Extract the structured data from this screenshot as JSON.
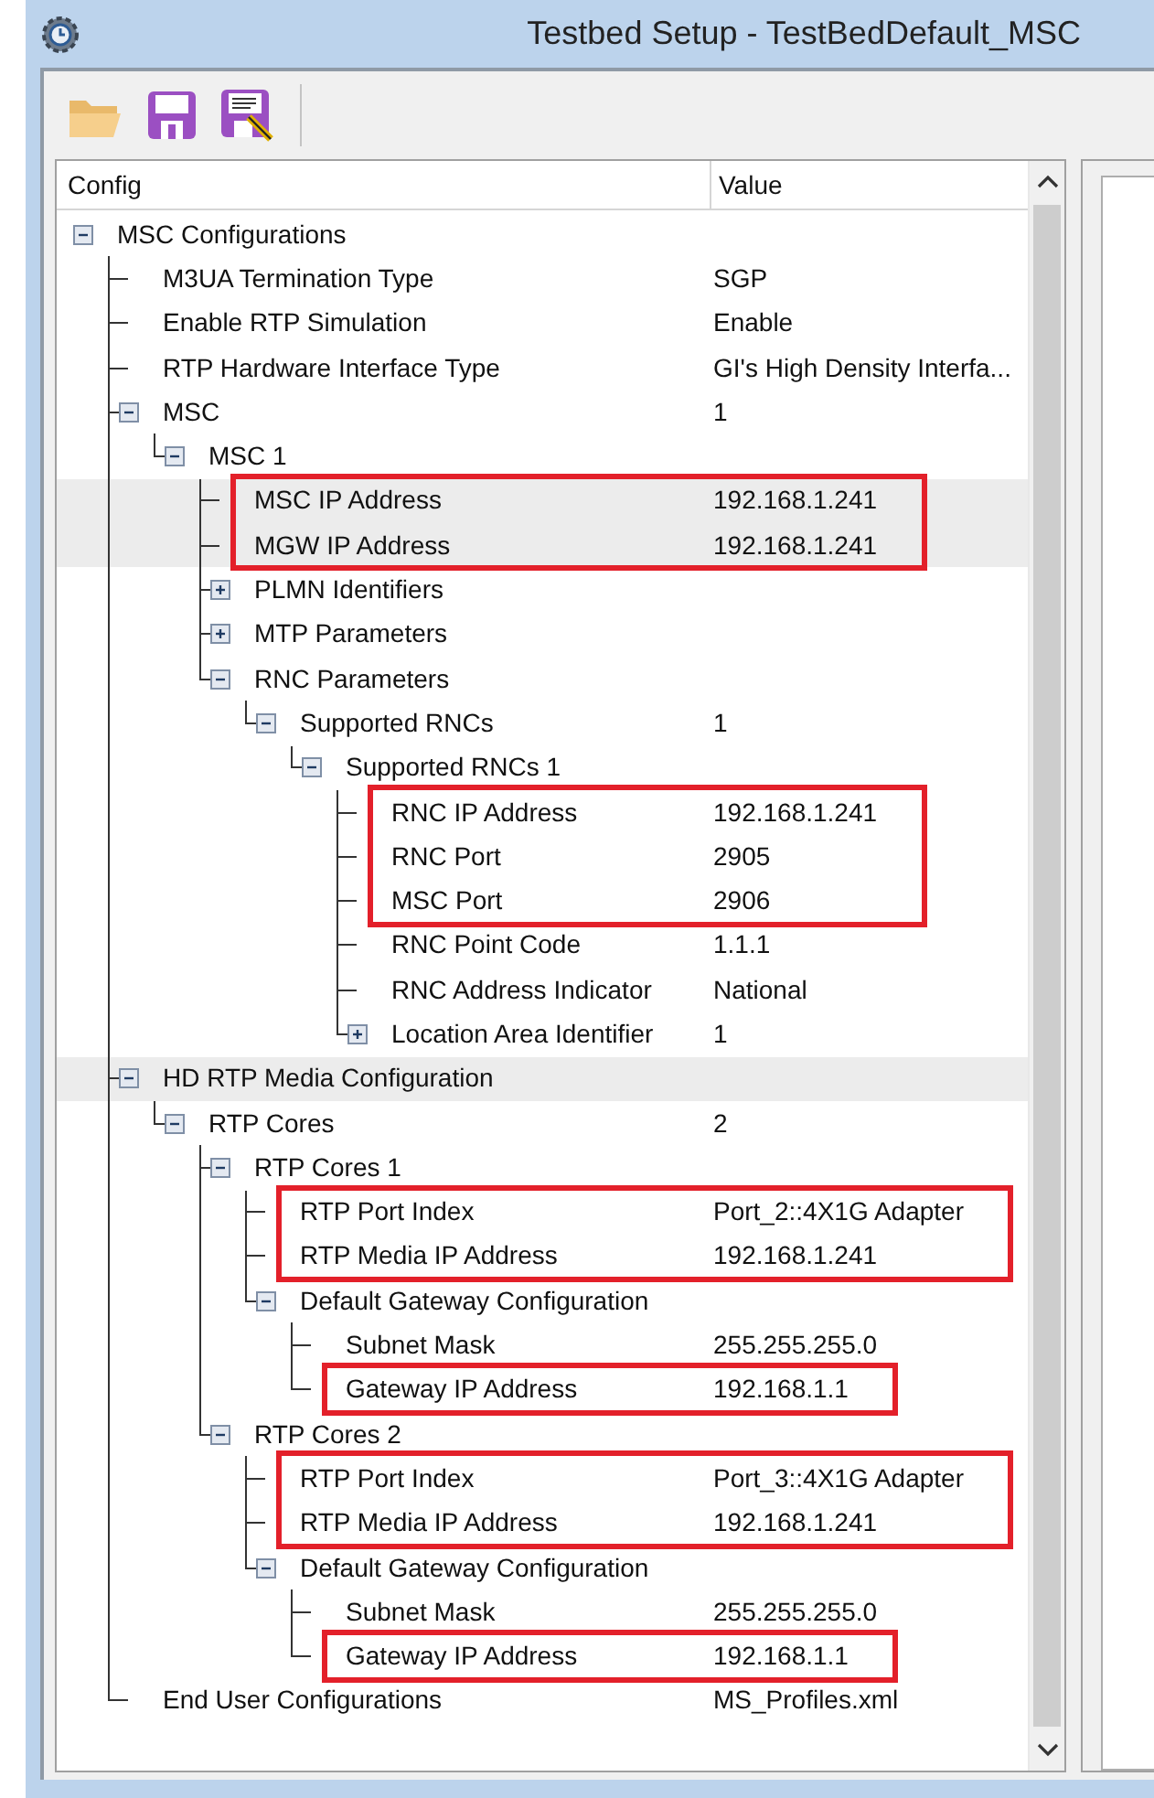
{
  "window": {
    "title": "Testbed Setup - TestBedDefault_MSC"
  },
  "columns": [
    "Config",
    "Value"
  ],
  "tree": [
    {
      "label": "MSC Configurations",
      "expanded": true,
      "selected": false,
      "highlighted": false,
      "children": [
        {
          "label": "M3UA Termination Type",
          "value": "SGP",
          "selected": false,
          "highlighted": false
        },
        {
          "label": "Enable RTP Simulation",
          "value": "Enable",
          "selected": false,
          "highlighted": false
        },
        {
          "label": "RTP Hardware Interface Type",
          "value": "GI's High Density Interfa...",
          "selected": false,
          "highlighted": false
        },
        {
          "label": "MSC",
          "value": "1",
          "expanded": true,
          "selected": false,
          "highlighted": false,
          "children": [
            {
              "label": "MSC 1",
              "expanded": true,
              "selected": false,
              "highlighted": false,
              "children": [
                {
                  "label": "MSC IP Address",
                  "value": "192.168.1.241",
                  "selected": true,
                  "highlighted": true
                },
                {
                  "label": "MGW IP Address",
                  "value": "192.168.1.241",
                  "selected": true,
                  "highlighted": true
                },
                {
                  "label": "PLMN Identifiers",
                  "expanded": false,
                  "selected": false,
                  "highlighted": false
                },
                {
                  "label": "MTP Parameters",
                  "expanded": false,
                  "selected": false,
                  "highlighted": false
                },
                {
                  "label": "RNC Parameters",
                  "expanded": true,
                  "selected": false,
                  "highlighted": false,
                  "children": [
                    {
                      "label": "Supported RNCs",
                      "value": "1",
                      "expanded": true,
                      "selected": false,
                      "highlighted": false,
                      "children": [
                        {
                          "label": "Supported RNCs 1",
                          "expanded": true,
                          "selected": false,
                          "highlighted": false,
                          "children": [
                            {
                              "label": "RNC IP Address",
                              "value": "192.168.1.241",
                              "selected": false,
                              "highlighted": true
                            },
                            {
                              "label": "RNC Port",
                              "value": "2905",
                              "selected": false,
                              "highlighted": true
                            },
                            {
                              "label": "MSC Port",
                              "value": "2906",
                              "selected": false,
                              "highlighted": true
                            },
                            {
                              "label": "RNC Point Code",
                              "value": "1.1.1",
                              "selected": false,
                              "highlighted": false
                            },
                            {
                              "label": "RNC Address Indicator",
                              "value": "National",
                              "selected": false,
                              "highlighted": false
                            },
                            {
                              "label": "Location Area Identifier",
                              "value": "1",
                              "expanded": false,
                              "selected": false,
                              "highlighted": false
                            }
                          ]
                        }
                      ]
                    }
                  ]
                }
              ]
            }
          ]
        },
        {
          "label": "HD RTP Media Configuration",
          "expanded": true,
          "selected": true,
          "highlighted": false,
          "children": [
            {
              "label": "RTP Cores",
              "value": "2",
              "expanded": true,
              "selected": false,
              "highlighted": false,
              "children": [
                {
                  "label": "RTP Cores 1",
                  "expanded": true,
                  "selected": false,
                  "highlighted": false,
                  "children": [
                    {
                      "label": "RTP Port Index",
                      "value": "Port_2::4X1G Adapter",
                      "selected": false,
                      "highlighted": true
                    },
                    {
                      "label": "RTP Media IP Address",
                      "value": "192.168.1.241",
                      "selected": false,
                      "highlighted": true
                    },
                    {
                      "label": "Default Gateway Configuration",
                      "expanded": true,
                      "selected": false,
                      "highlighted": false,
                      "children": [
                        {
                          "label": "Subnet Mask",
                          "value": "255.255.255.0",
                          "selected": false,
                          "highlighted": false
                        },
                        {
                          "label": "Gateway IP Address",
                          "value": "192.168.1.1",
                          "selected": false,
                          "highlighted": true
                        }
                      ]
                    }
                  ]
                },
                {
                  "label": "RTP Cores 2",
                  "expanded": true,
                  "selected": false,
                  "highlighted": false,
                  "children": [
                    {
                      "label": "RTP Port Index",
                      "value": "Port_3::4X1G Adapter",
                      "selected": false,
                      "highlighted": true
                    },
                    {
                      "label": "RTP Media IP Address",
                      "value": "192.168.1.241",
                      "selected": false,
                      "highlighted": true
                    },
                    {
                      "label": "Default Gateway Configuration",
                      "expanded": true,
                      "selected": false,
                      "highlighted": false,
                      "children": [
                        {
                          "label": "Subnet Mask",
                          "value": "255.255.255.0",
                          "selected": false,
                          "highlighted": false
                        },
                        {
                          "label": "Gateway IP Address",
                          "value": "192.168.1.1",
                          "selected": false,
                          "highlighted": true
                        }
                      ]
                    }
                  ]
                }
              ]
            }
          ]
        },
        {
          "label": "End User Configurations",
          "value": "MS_Profiles.xml",
          "selected": false,
          "highlighted": false
        }
      ]
    }
  ]
}
